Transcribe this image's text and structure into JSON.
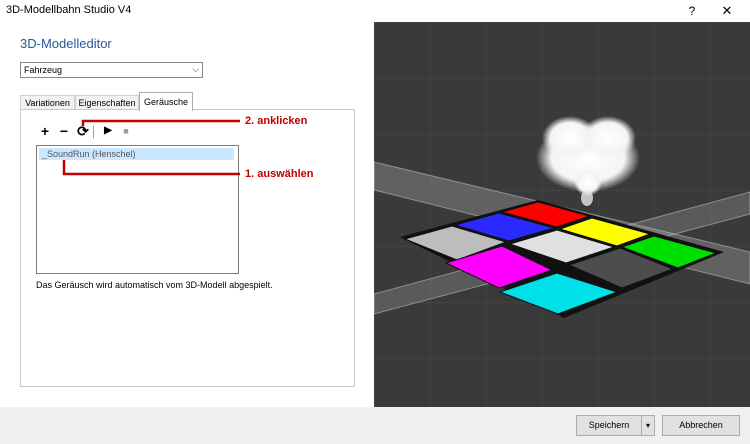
{
  "window": {
    "title": "3D-Modellbahn Studio V4",
    "help": "?",
    "close": "✕"
  },
  "editor": {
    "heading": "3D-Modelleditor",
    "type_select": {
      "value": "Fahrzeug",
      "arrow": "⌵"
    },
    "tabs": [
      {
        "label": "Variationen"
      },
      {
        "label": "Eigenschaften"
      },
      {
        "label": "Geräusche"
      }
    ],
    "toolbar": {
      "add": "+",
      "remove": "−",
      "refresh": "⟳",
      "play": "▶",
      "stop": "■"
    },
    "sound_list": [
      "_SoundRun (Henschel)"
    ],
    "info_text": "Das Geräusch wird automatisch vom 3D-Modell abgespielt."
  },
  "annotations": {
    "step1": "1.  auswählen",
    "step2": "2.  anklicken",
    "color": "#c00000"
  },
  "viewport_tiles": [
    {
      "name": "red",
      "color": "#ff0000"
    },
    {
      "name": "blue",
      "color": "#2a2aff"
    },
    {
      "name": "yellow",
      "color": "#ffff00"
    },
    {
      "name": "green",
      "color": "#00e000"
    },
    {
      "name": "light-gray",
      "color": "#e0e0e0"
    },
    {
      "name": "magenta",
      "color": "#ff00ff"
    },
    {
      "name": "cyan",
      "color": "#00e0e8"
    },
    {
      "name": "dark-gray",
      "color": "#4d4d4d"
    },
    {
      "name": "silver",
      "color": "#bdbdbd"
    }
  ],
  "footer": {
    "save": "Speichern",
    "save_arrow": "▾",
    "cancel": "Abbrechen"
  }
}
